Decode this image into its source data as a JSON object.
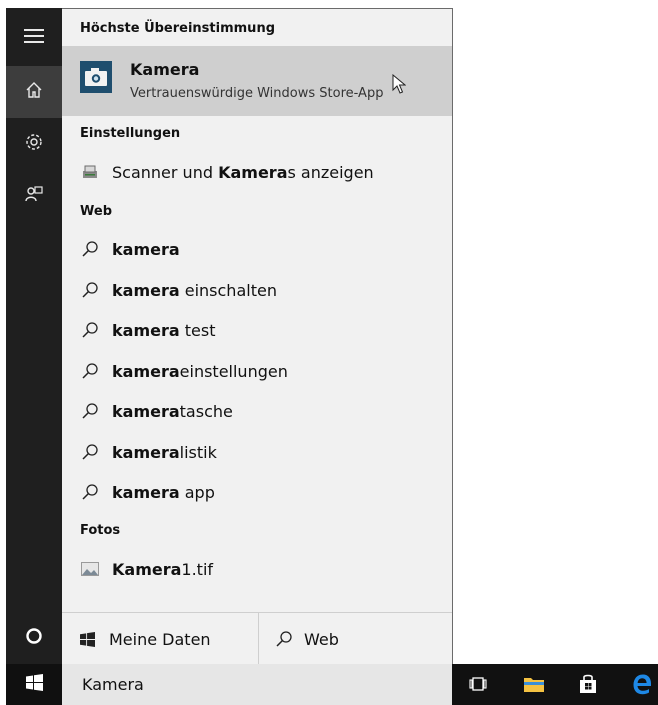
{
  "sidebar": {
    "menu_icon": "hamburger-icon",
    "items": [
      {
        "icon": "home-icon",
        "active": true
      },
      {
        "icon": "gear-icon",
        "active": false
      },
      {
        "icon": "feedback-icon",
        "active": false
      }
    ],
    "cortana_icon": "circle-icon",
    "start_icon": "windows-logo-icon"
  },
  "results": {
    "best_match_header": "Höchste Übereinstimmung",
    "best_match": {
      "title": "Kamera",
      "subtitle": "Vertrauenswürdige Windows Store-App",
      "icon": "camera-icon"
    },
    "settings_header": "Einstellungen",
    "settings_item": {
      "prefix": "Scanner und ",
      "bold": "Kamera",
      "suffix": "s anzeigen",
      "icon": "scanner-icon"
    },
    "web_header": "Web",
    "web_items": [
      {
        "bold": "kamera",
        "rest": ""
      },
      {
        "bold": "kamera",
        "rest": " einschalten"
      },
      {
        "bold": "kamera",
        "rest": " test"
      },
      {
        "bold": "kamera",
        "rest": "einstellungen"
      },
      {
        "bold": "kamera",
        "rest": "tasche"
      },
      {
        "bold": "kamera",
        "rest": "listik"
      },
      {
        "bold": "kamera",
        "rest": " app"
      }
    ],
    "photos_header": "Fotos",
    "photo_item": {
      "bold": "Kamera",
      "rest": "1.tif",
      "icon": "image-icon"
    }
  },
  "filters": {
    "my_stuff": "Meine Daten",
    "web": "Web"
  },
  "search": {
    "value": "Kamera"
  },
  "taskbar": {
    "icons": [
      "task-view-icon",
      "file-explorer-icon",
      "store-icon",
      "edge-icon"
    ]
  },
  "colors": {
    "rail": "#1f1f1f",
    "selected_row": "#cfcfcf",
    "panel": "#f1f1f1",
    "taskbar": "#111111",
    "edge_blue": "#1e88e5",
    "folder_yellow": "#f5c242"
  }
}
